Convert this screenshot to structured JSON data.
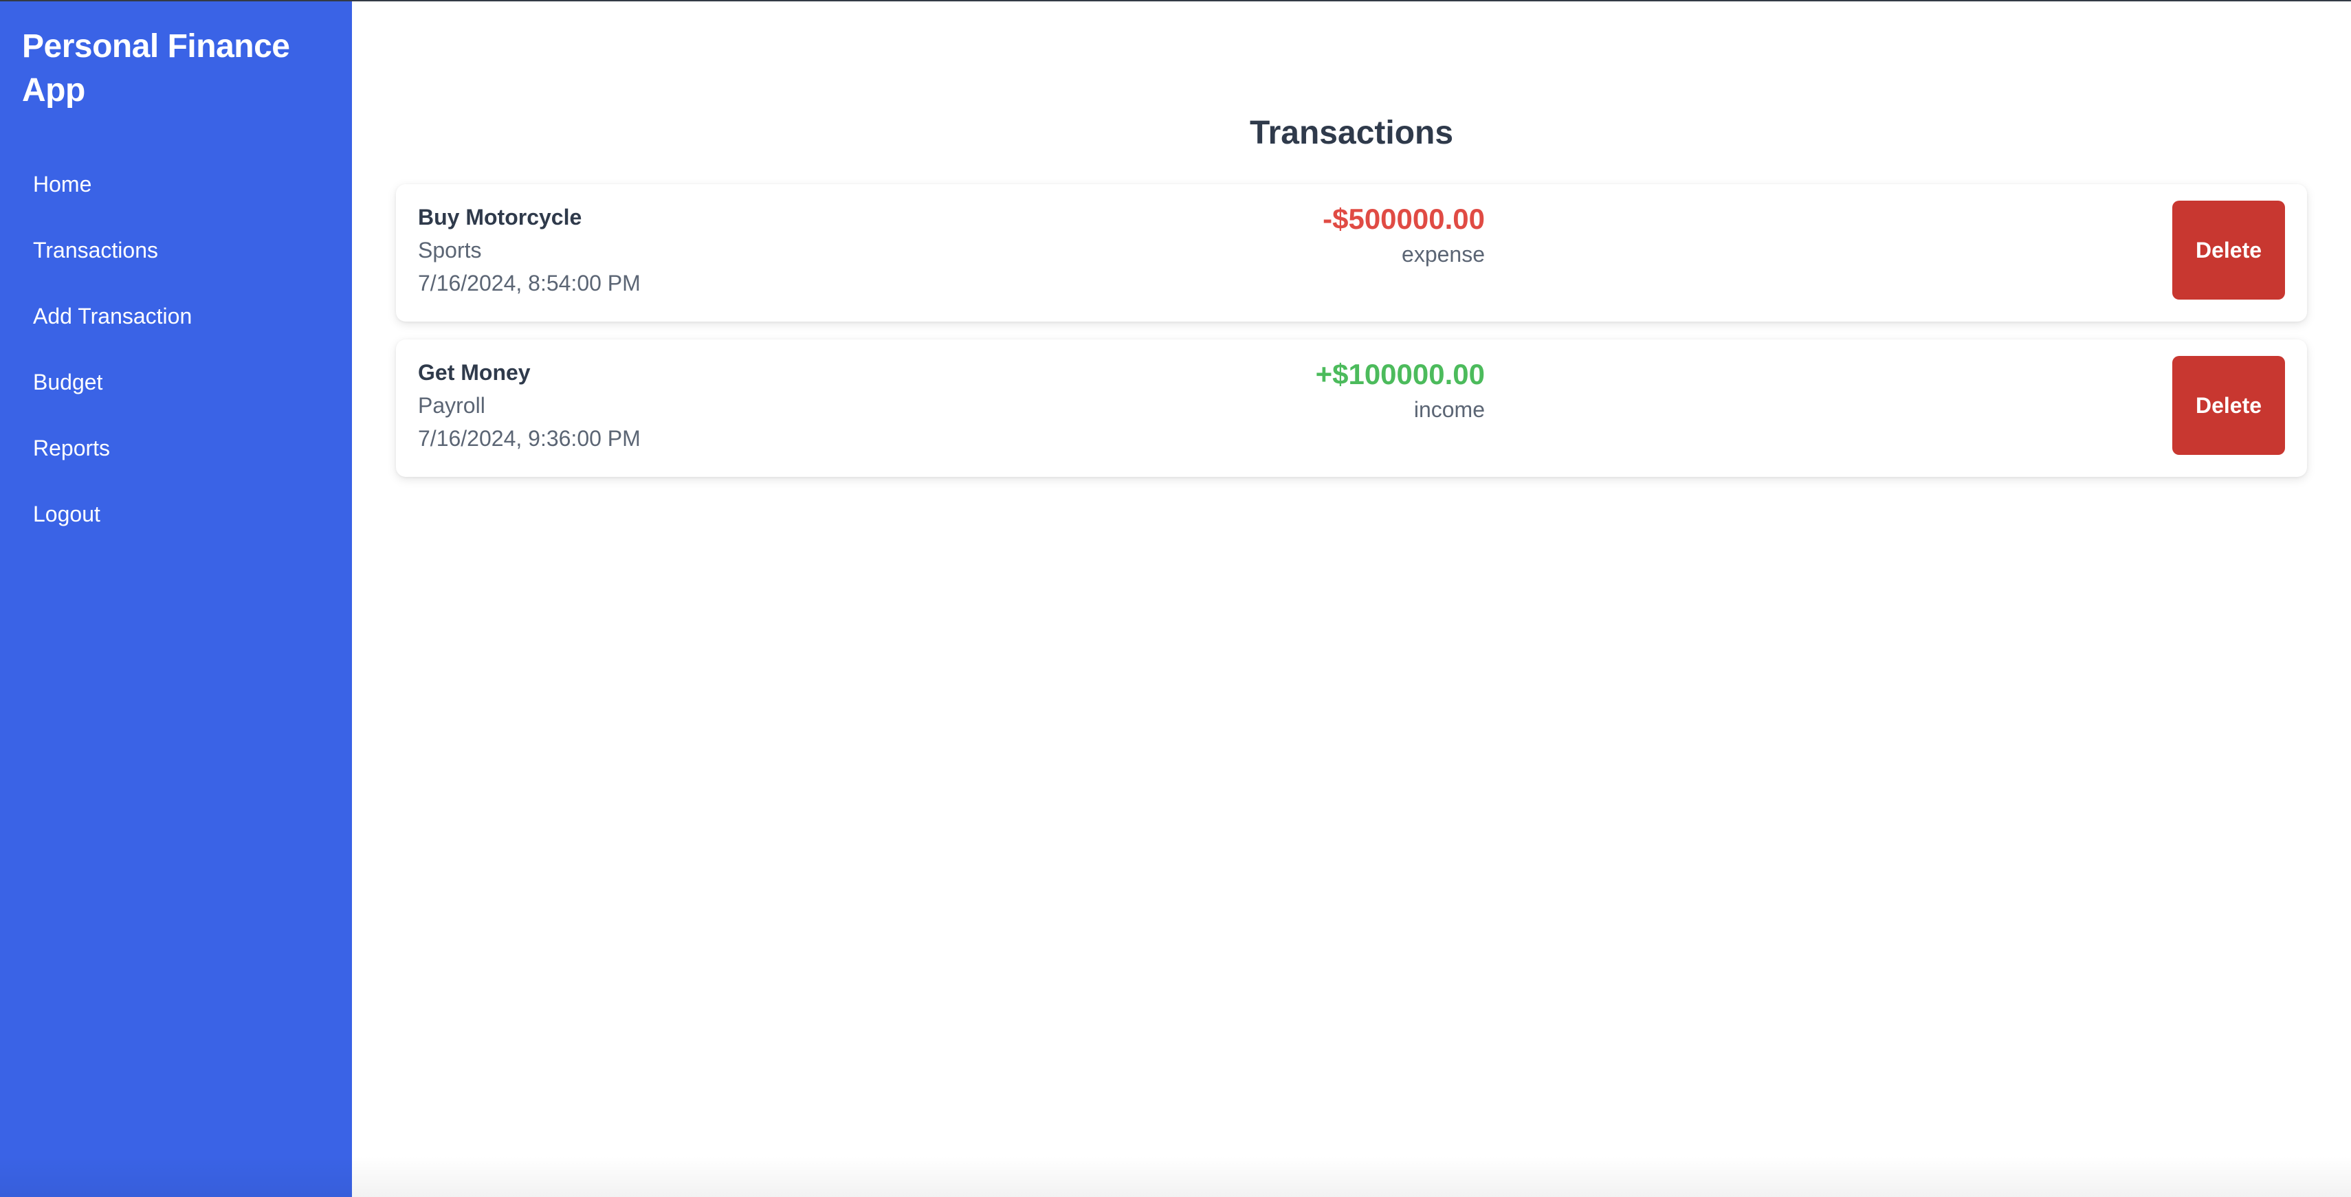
{
  "app": {
    "title": "Personal Finance App"
  },
  "sidebar": {
    "items": [
      {
        "label": "Home"
      },
      {
        "label": "Transactions"
      },
      {
        "label": "Add Transaction"
      },
      {
        "label": "Budget"
      },
      {
        "label": "Reports"
      },
      {
        "label": "Logout"
      }
    ]
  },
  "main": {
    "title": "Transactions",
    "transactions": [
      {
        "description": "Buy Motorcycle",
        "category": "Sports",
        "date": "7/16/2024, 8:54:00 PM",
        "amount": "-$500000.00",
        "type": "expense",
        "delete_label": "Delete"
      },
      {
        "description": "Get Money",
        "category": "Payroll",
        "date": "7/16/2024, 9:36:00 PM",
        "amount": "+$100000.00",
        "type": "income",
        "delete_label": "Delete"
      }
    ]
  },
  "colors": {
    "sidebar_bg": "#3a63e6",
    "expense": "#e04b44",
    "income": "#4cbb5c",
    "delete_button": "#c83730",
    "heading": "#2f3a4b",
    "muted_text": "#5b6574"
  }
}
